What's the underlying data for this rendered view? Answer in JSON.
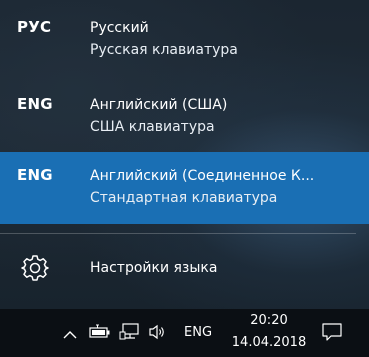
{
  "languages": [
    {
      "code": "РУС",
      "name": "Русский",
      "keyboard": "Русская клавиатура"
    },
    {
      "code": "ENG",
      "name": "Английский (США)",
      "keyboard": "США клавиатура"
    },
    {
      "code": "ENG",
      "name": "Английский (Соединенное К...",
      "keyboard": "Стандартная клавиатура"
    }
  ],
  "selected_index": 2,
  "settings": {
    "label": "Настройки языка",
    "icon": "gear-icon"
  },
  "taskbar": {
    "language": "ENG",
    "time": "20:20",
    "date": "14.04.2018",
    "icons": [
      "chevron-up-icon",
      "battery-icon",
      "network-icon",
      "speaker-icon",
      "notification-icon"
    ]
  },
  "colors": {
    "selected": "#1a6fb4",
    "flyout_bg": "#1e2a35",
    "taskbar_bg": "#0b0f14"
  }
}
